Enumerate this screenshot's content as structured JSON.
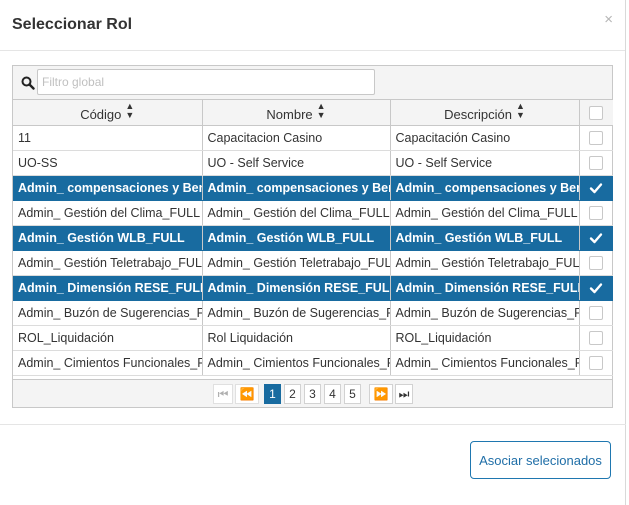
{
  "modal": {
    "title": "Seleccionar Rol",
    "close_glyph": "×"
  },
  "filter": {
    "placeholder": "Filtro global",
    "value": ""
  },
  "columns": [
    "Código",
    "Nombre",
    "Descripción"
  ],
  "rows": [
    {
      "codigo": "11",
      "nombre": "Capacitacion Casino",
      "descripcion": "Capacitación Casino",
      "selected": false
    },
    {
      "codigo": "UO-SS",
      "nombre": "UO - Self Service",
      "descripcion": "UO - Self Service",
      "selected": false
    },
    {
      "codigo": "Admin_ compensaciones y Bene",
      "nombre": "Admin_ compensaciones y Bene",
      "descripcion": "Admin_ compensaciones y Bene",
      "selected": true
    },
    {
      "codigo": "Admin_ Gestión del Clima_FULL",
      "nombre": "Admin_ Gestión del Clima_FULL",
      "descripcion": "Admin_ Gestión del Clima_FULL",
      "selected": false
    },
    {
      "codigo": "Admin_ Gestión WLB_FULL",
      "nombre": "Admin_ Gestión WLB_FULL",
      "descripcion": "Admin_ Gestión WLB_FULL",
      "selected": true
    },
    {
      "codigo": "Admin_ Gestión Teletrabajo_FULL",
      "nombre": "Admin_ Gestión Teletrabajo_FUL",
      "descripcion": "Admin_ Gestión Teletrabajo_FUL",
      "selected": false
    },
    {
      "codigo": "Admin_ Dimensión RESE_FULL",
      "nombre": "Admin_ Dimensión RESE_FULL",
      "descripcion": "Admin_ Dimensión RESE_FULL",
      "selected": true
    },
    {
      "codigo": "Admin_ Buzón de Sugerencias_F",
      "nombre": "Admin_ Buzón de Sugerencias_F",
      "descripcion": "Admin_ Buzón de Sugerencias_F",
      "selected": false
    },
    {
      "codigo": "ROL_Liquidación",
      "nombre": "Rol Liquidación",
      "descripcion": "ROL_Liquidación",
      "selected": false
    },
    {
      "codigo": "Admin_ Cimientos Funcionales_F",
      "nombre": "Admin_ Cimientos Funcionales_F",
      "descripcion": "Admin_ Cimientos Funcionales_F",
      "selected": false
    }
  ],
  "paginator": {
    "pages": [
      "1",
      "2",
      "3",
      "4",
      "5"
    ],
    "current": "1",
    "first_glyph": "⏮",
    "prev_glyph": "⏪",
    "next_glyph": "⏩",
    "last_glyph": "⏭"
  },
  "footer": {
    "associate_label": "Asociar selecionados"
  },
  "colors": {
    "selected_row": "#186ba0",
    "active_page": "#186ba0",
    "button_border": "#1f77b0"
  },
  "icons": {
    "search": "search-icon",
    "sort": "sort-icon",
    "checkmark": "checkmark-icon"
  }
}
